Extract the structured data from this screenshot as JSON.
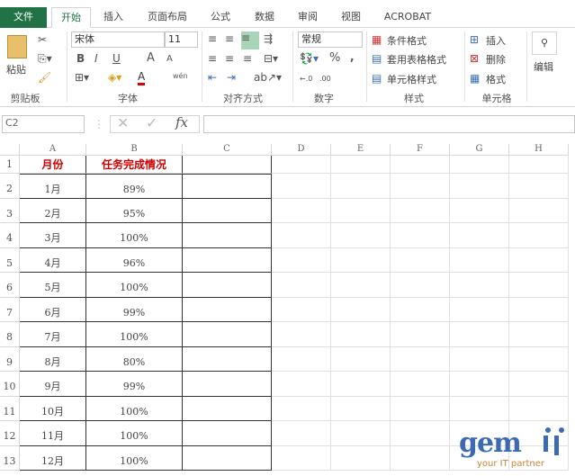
{
  "tabs": [
    "文件",
    "开始",
    "插入",
    "页面布局",
    "公式",
    "数据",
    "审阅",
    "视图",
    "ACROBAT"
  ],
  "ribbon": {
    "clipboard": {
      "paste": "粘贴",
      "label": "剪贴板"
    },
    "font": {
      "name": "宋体",
      "size": "11",
      "label": "字体",
      "bold": "B",
      "italic": "I",
      "underline": "U",
      "grow": "A",
      "shrink": "A",
      "phonetic": "wén"
    },
    "alignment": {
      "label": "对齐方式"
    },
    "number": {
      "format": "常规",
      "percent": "%",
      "comma": ",",
      "inc": "←.0",
      "dec": ".00",
      "label": "数字"
    },
    "styles": {
      "conditional": "条件格式",
      "table": "套用表格格式",
      "cell": "单元格样式",
      "label": "样式"
    },
    "cells": {
      "insert": "插入",
      "delete": "删除",
      "format": "格式",
      "label": "单元格"
    },
    "editing": {
      "label": "编辑"
    }
  },
  "formula_bar": {
    "name_box": "C2",
    "value": "",
    "fx": "fx"
  },
  "columns": [
    "A",
    "B",
    "C",
    "D",
    "E",
    "F",
    "G",
    "H"
  ],
  "rows": [
    "1",
    "2",
    "3",
    "4",
    "5",
    "6",
    "7",
    "8",
    "9",
    "10",
    "11",
    "12",
    "13"
  ],
  "table": {
    "headers": [
      "月份",
      "任务完成情况"
    ],
    "data": [
      [
        "1月",
        "89%"
      ],
      [
        "2月",
        "95%"
      ],
      [
        "3月",
        "100%"
      ],
      [
        "4月",
        "96%"
      ],
      [
        "5月",
        "100%"
      ],
      [
        "6月",
        "99%"
      ],
      [
        "7月",
        "100%"
      ],
      [
        "8月",
        "80%"
      ],
      [
        "9月",
        "99%"
      ],
      [
        "10月",
        "100%"
      ],
      [
        "11月",
        "100%"
      ],
      [
        "12月",
        "100%"
      ]
    ]
  },
  "watermark": {
    "brand": "gemini",
    "tagline": "your IT partner"
  },
  "colors": {
    "accent": "#217346",
    "header_text": "#d00000",
    "logo": "#3d6bb3",
    "tagline": "#c8843a"
  }
}
